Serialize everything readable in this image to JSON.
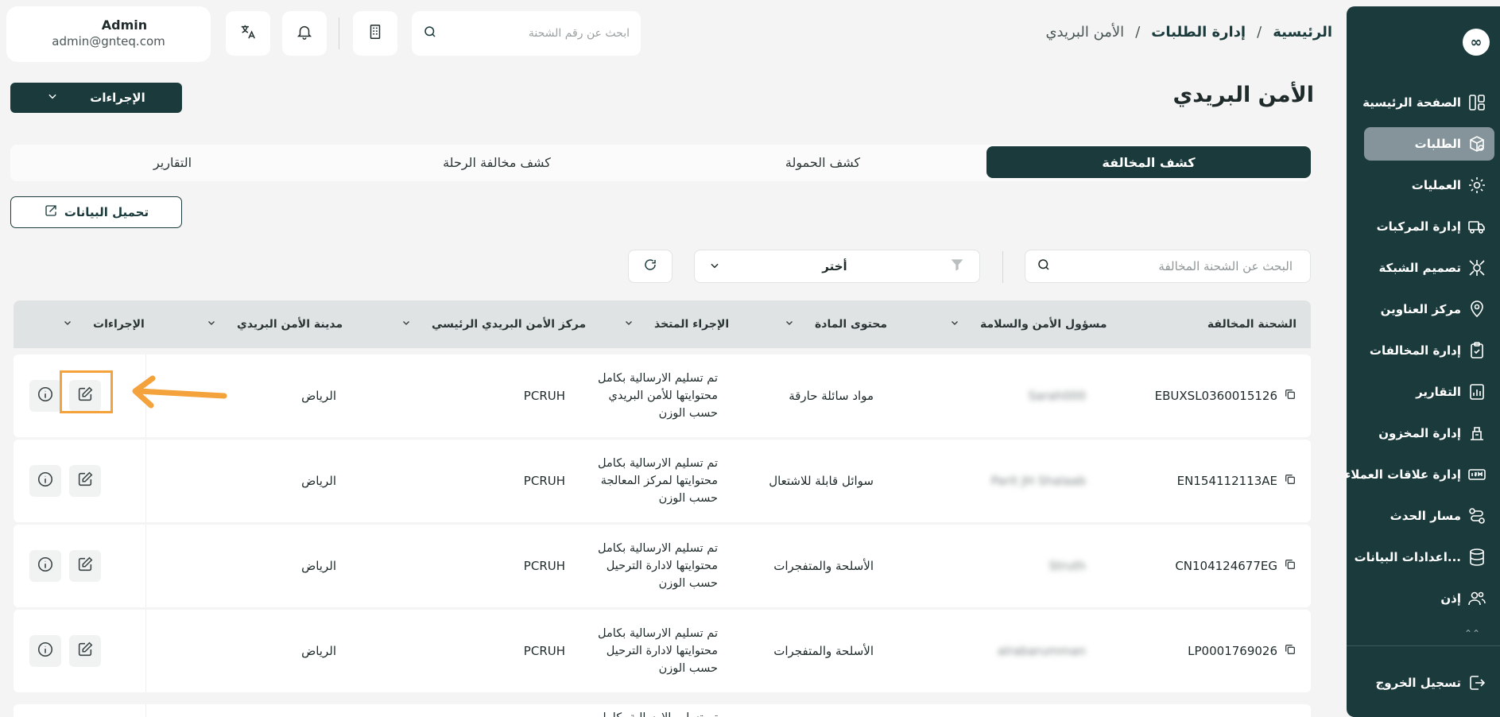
{
  "sidebar": {
    "logo": "∞",
    "items": [
      {
        "label": "الصفحة الرئيسية",
        "icon": "dashboard-icon"
      },
      {
        "label": "الطلبات",
        "icon": "package-icon",
        "active": true
      },
      {
        "label": "العمليات",
        "icon": "gear-icon"
      },
      {
        "label": "إدارة المركبات",
        "icon": "truck-icon"
      },
      {
        "label": "تصميم الشبكة",
        "icon": "network-icon"
      },
      {
        "label": "مركز العناوين",
        "icon": "location-icon"
      },
      {
        "label": "إدارة المخالفات",
        "icon": "clipboard-icon"
      },
      {
        "label": "التقارير",
        "icon": "report-icon"
      },
      {
        "label": "إدارة المخزون",
        "icon": "warehouse-icon"
      },
      {
        "label": "إدارة علاقات العملاء",
        "icon": "crm-icon"
      },
      {
        "label": "مسار الحدث",
        "icon": "route-icon"
      },
      {
        "label": "اعدادات البيانات...",
        "icon": "database-icon"
      },
      {
        "label": "إذن",
        "icon": "users-icon"
      }
    ],
    "logout": "تسجيل الخروج"
  },
  "breadcrumb": {
    "home": "الرئيسية",
    "section": "إدارة الطلبات",
    "current": "الأمن البريدي",
    "separator": "/"
  },
  "header": {
    "search_placeholder": "ابحث عن رقم الشحنة",
    "user_name": "Admin",
    "user_email": "admin@gnteq.com"
  },
  "page": {
    "title": "الأمن البريدي",
    "actions_label": "الإجراءات",
    "load_data_label": "تحميل البيانات"
  },
  "tabs": [
    {
      "label": "كشف المخالفة",
      "active": true
    },
    {
      "label": "كشف الحمولة"
    },
    {
      "label": "كشف مخالفة الرحلة"
    },
    {
      "label": "التقارير"
    }
  ],
  "filters": {
    "search_placeholder": "البحث عن الشحنة المخالفة",
    "select_value": "أختر"
  },
  "table": {
    "columns": {
      "shipment": "الشحنة المخالفة",
      "officer": "مسؤول الأمن والسلامة",
      "content": "محتوى المادة",
      "action_taken": "الإجراء المتخذ",
      "center": "مركز الأمن البريدي الرئيسي",
      "city": "مدينة الأمن البريدي",
      "actions": "الإجراءات"
    },
    "rows": [
      {
        "shipment": "EBUXSL0360015126",
        "officer": "Sarah000",
        "content": "مواد سائلة حارقة",
        "action_lines": [
          "تم تسليم الارسالية بكامل",
          "محتوايتها للأمن البريدي",
          "حسب الوزن"
        ],
        "center": "PCRUH",
        "city": "الرياض"
      },
      {
        "shipment": "EN154112113AE",
        "officer": "Parit JH Shalaab",
        "content": "سوائل قابلة للاشتعال",
        "action_lines": [
          "تم تسليم الارسالية بكامل",
          "محتوايتها لمركز المعالجة",
          "حسب الوزن"
        ],
        "center": "PCRUH",
        "city": "الرياض"
      },
      {
        "shipment": "CN104124677EG",
        "officer": "Struth",
        "content": "الأسلحة والمتفجرات",
        "action_lines": [
          "تم تسليم الارسالية بكامل",
          "محتوايتها لادارة الترحيل",
          "حسب الوزن"
        ],
        "center": "PCRUH",
        "city": "الرياض"
      },
      {
        "shipment": "LP0001769026",
        "officer": "alrabarumman",
        "content": "الأسلحة والمتفجرات",
        "action_lines": [
          "تم تسليم الارسالية بكامل",
          "محتوايتها لادارة الترحيل",
          "حسب الوزن"
        ],
        "center": "PCRUH",
        "city": "الرياض"
      }
    ],
    "partial_row_text": "تم تسليم الارسالية بكامل"
  },
  "colors": {
    "primary": "#1b3a3c",
    "sidebar_active": "#85949a",
    "background": "#f3f4f3",
    "highlight": "#f4a23b"
  }
}
